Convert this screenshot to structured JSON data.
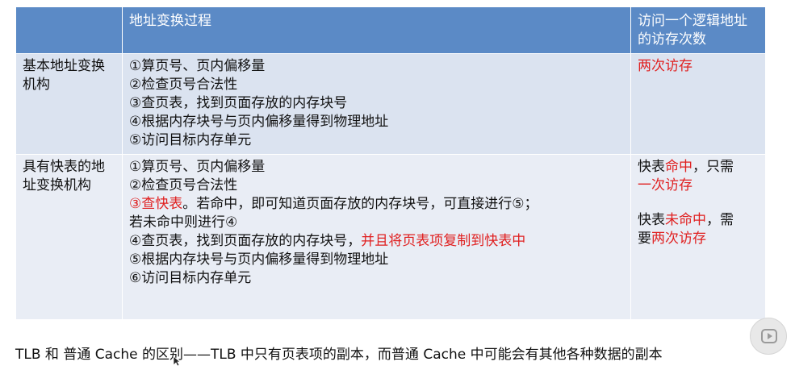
{
  "table": {
    "headers": [
      "",
      "地址变换过程",
      "访问一个逻辑地址的访存次数"
    ],
    "rows": [
      {
        "name": "基本地址变换机构",
        "steps": [
          [
            {
              "t": "①算页号、页内偏移量"
            }
          ],
          [
            {
              "t": "②检查页号合法性"
            }
          ],
          [
            {
              "t": "③查页表，找到页面存放的内存块号"
            }
          ],
          [
            {
              "t": "④根据内存块号与页内偏移量得到物理地址"
            }
          ],
          [
            {
              "t": "⑤访问目标内存单元"
            }
          ]
        ],
        "access": [
          [
            {
              "t": "两次访存",
              "red": true
            }
          ]
        ]
      },
      {
        "name": "具有快表的地址变换机构",
        "steps": [
          [
            {
              "t": "①算页号、页内偏移量"
            }
          ],
          [
            {
              "t": "②检查页号合法性"
            }
          ],
          [
            {
              "t": "③查快表",
              "red": true
            },
            {
              "t": "。若命中，即可知道页面存放的内存块号，可直接进行⑤；"
            }
          ],
          [
            {
              "t": "若未命中则进行④"
            }
          ],
          [
            {
              "t": "④查页表，找到页面存放的内存块号，"
            },
            {
              "t": "并且将页表项复制到快表中",
              "red": true
            }
          ],
          [
            {
              "t": "⑤根据内存块号与页内偏移量得到物理地址"
            }
          ],
          [
            {
              "t": "⑥访问目标内存单元"
            }
          ]
        ],
        "access": [
          [
            {
              "t": "快表"
            },
            {
              "t": "命中",
              "red": true
            },
            {
              "t": "，只需"
            }
          ],
          [
            {
              "t": "一次访存",
              "red": true
            }
          ],
          [],
          [
            {
              "t": "快表"
            },
            {
              "t": "未命中",
              "red": true
            },
            {
              "t": "，需"
            }
          ],
          [
            {
              "t": "要"
            },
            {
              "t": "两次访存",
              "red": true
            }
          ]
        ]
      }
    ]
  },
  "footer": "TLB 和 普通 Cache 的区别——TLB 中只有页表项的副本，而普通 Cache 中可能会有其他各种数据的副本",
  "icons": {
    "play": "play-icon",
    "cursor": "mouse-cursor-icon"
  },
  "colors": {
    "header_bg": "#5b8ac6",
    "row1_bg": "#dbe3f0",
    "row2_bg": "#e9edf5",
    "highlight": "#e02020"
  }
}
